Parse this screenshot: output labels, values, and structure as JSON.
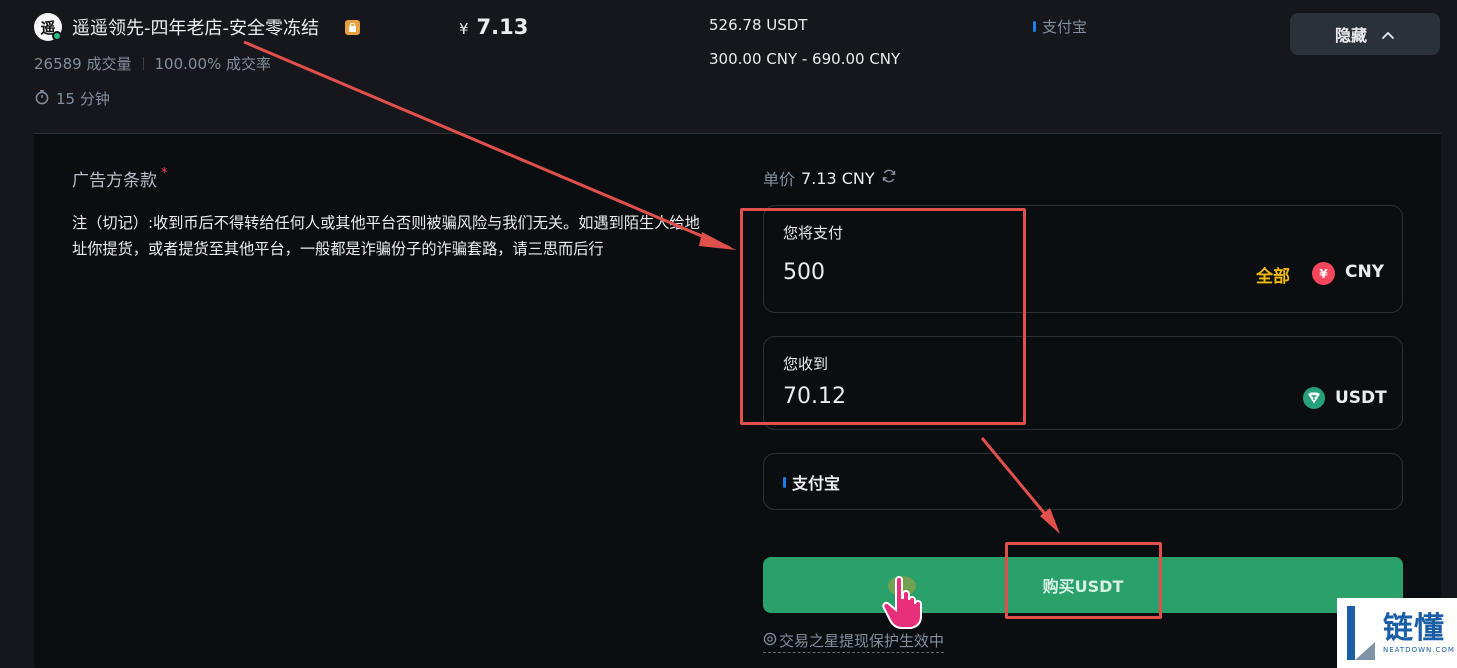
{
  "merchant": {
    "avatar_char": "遥",
    "name": "遥遥领先-四年老店-安全零冻结",
    "orders": "26589 成交量",
    "completion": "100.00% 成交率",
    "pay_time": "15 分钟"
  },
  "listing": {
    "currency_symbol": "¥",
    "price": "7.13",
    "available": "526.78 USDT",
    "limit": "300.00 CNY - 690.00 CNY",
    "payment_method": "支付宝",
    "hide_label": "隐藏"
  },
  "terms": {
    "title": "广告方条款",
    "required_mark": "*",
    "body": "注（切记）:收到币后不得转给任何人或其他平台否则被骗风险与我们无关。如遇到陌生人给地址你提货，或者提货至其他平台，一般都是诈骗份子的诈骗套路，请三思而后行"
  },
  "order_form": {
    "unit_price_label": "单价",
    "unit_price_value": "7.13 CNY",
    "pay": {
      "label": "您将支付",
      "value": "500",
      "all_label": "全部",
      "currency_icon_char": "¥",
      "currency": "CNY"
    },
    "receive": {
      "label": "您收到",
      "value": "70.12",
      "currency": "USDT"
    },
    "payment_method": "支付宝",
    "buy_label": "购买USDT",
    "protection_text": "交易之星提现保护生效中"
  },
  "watermark": {
    "text_cn": "链懂",
    "text_en": "NEATDOWN.COM"
  },
  "colors": {
    "background": "#15171c",
    "panel": "#0b0e11",
    "accent_gold": "#f0b90b",
    "buy_green": "#2aa06b",
    "annotation_red": "#e2504c",
    "alipay_blue": "#1d7cf2"
  },
  "icons": {
    "timer": "stopwatch-icon",
    "badge": "merchant-badge-icon",
    "chevron": "chevron-up-icon",
    "refresh": "refresh-icon",
    "cny": "cny-coin-icon",
    "usdt": "usdt-coin-icon",
    "pointer": "hand-pointer-icon",
    "protect": "shield-icon"
  }
}
